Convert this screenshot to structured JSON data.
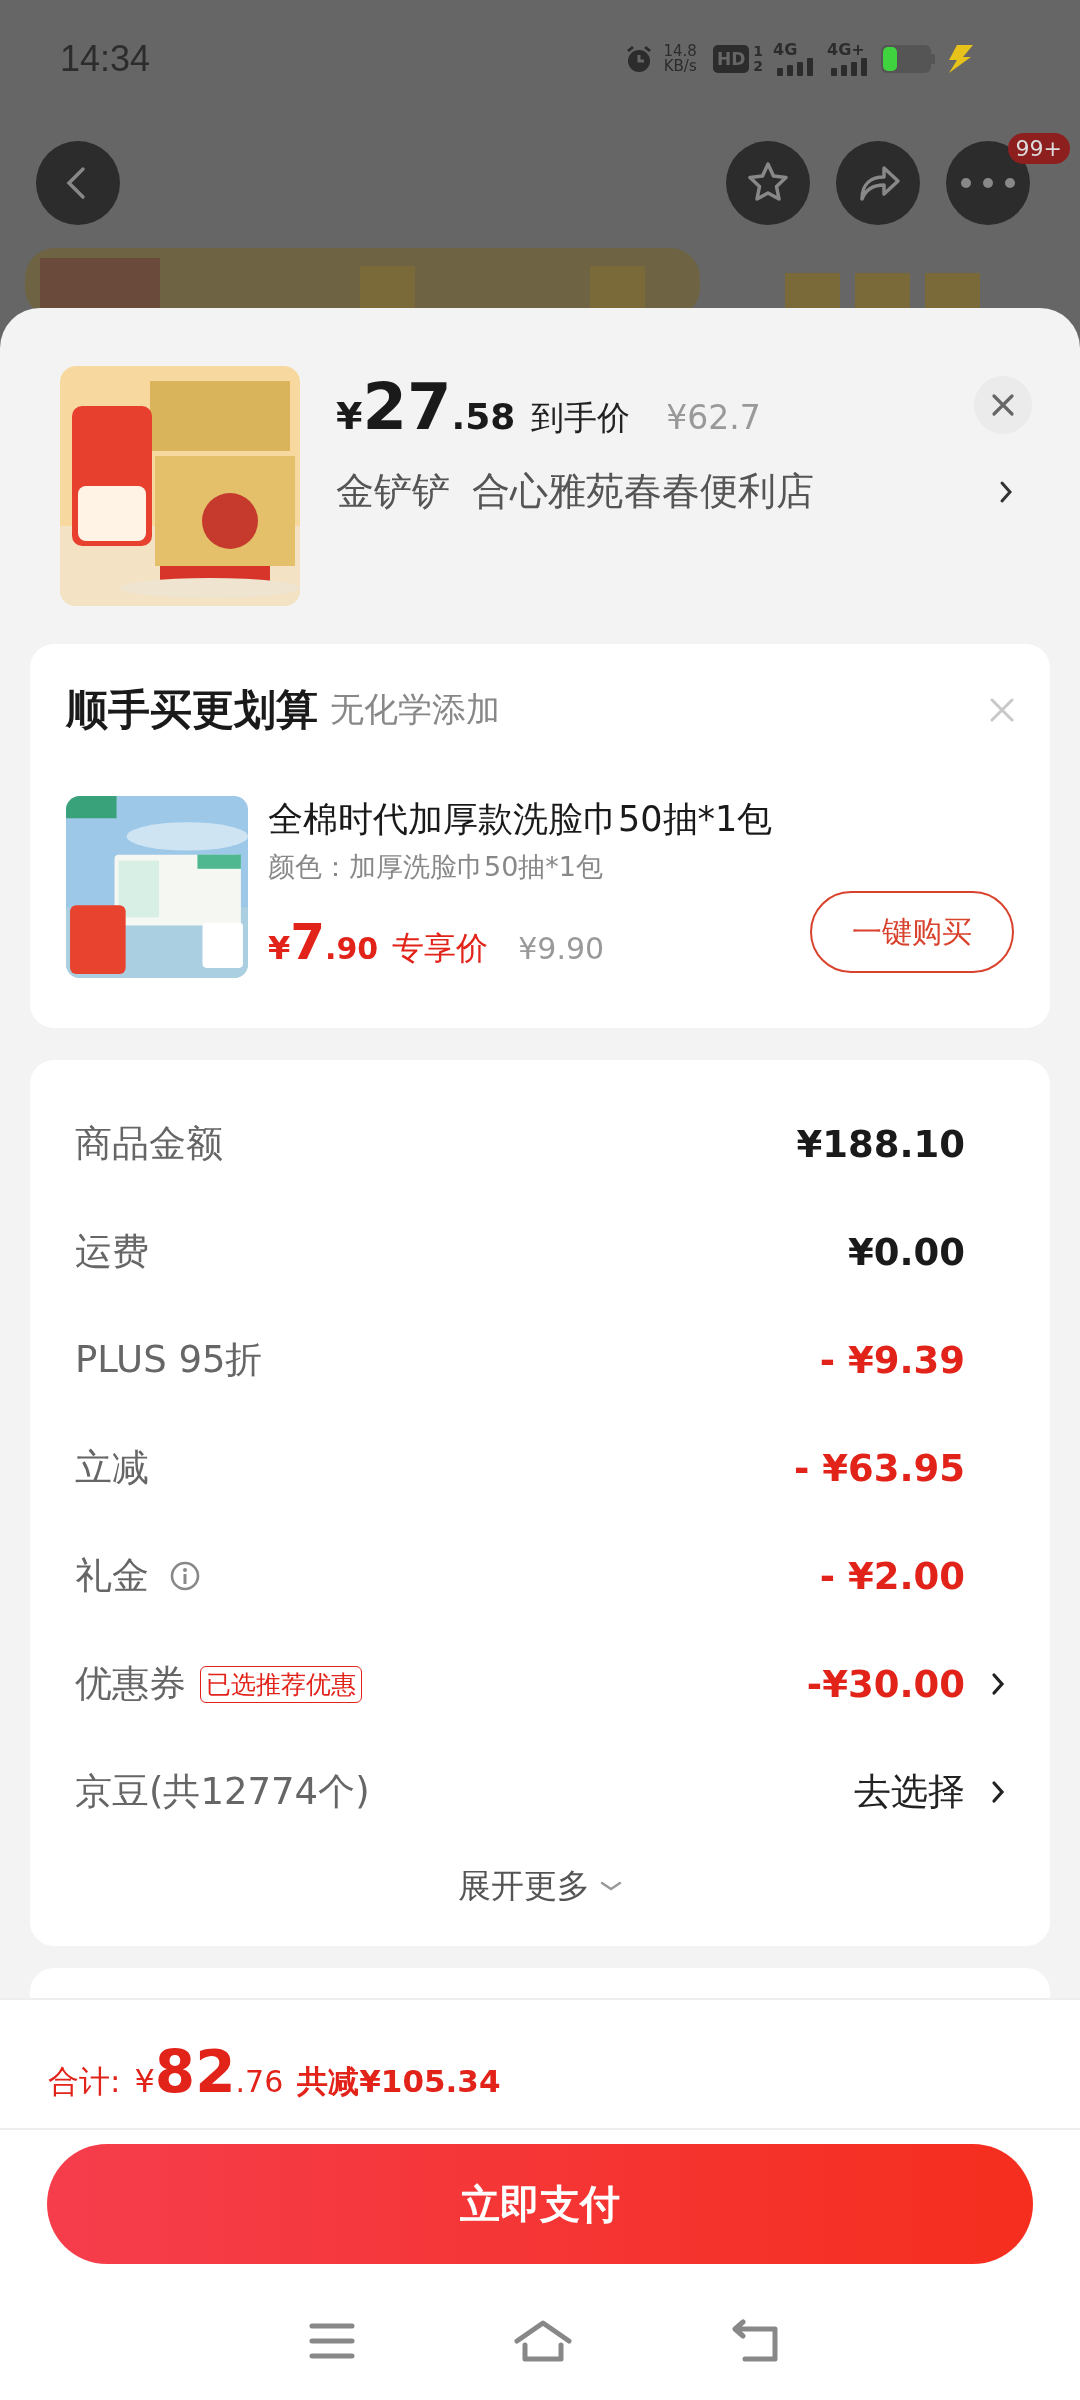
{
  "status_bar": {
    "time": "14:34",
    "speed": [
      "14.8",
      "KB/s"
    ],
    "hd": {
      "label": "HD",
      "sims": [
        "1",
        "2"
      ]
    },
    "signals": [
      "4G",
      "4G+"
    ]
  },
  "top_actions": {
    "more_badge": "99+"
  },
  "product": {
    "currency": "¥",
    "price_int": "27",
    "price_dec": ".58",
    "price_label": "到手价",
    "original_price": "¥62.7",
    "address": [
      "金铲铲",
      "合心雅苑春春便利店"
    ]
  },
  "upsell": {
    "title": "顺手买更划算",
    "subtitle": "无化学添加",
    "item": {
      "name": "全棉时代加厚款洗脸巾50抽*1包",
      "spec": "颜色：加厚洗脸巾50抽*1包",
      "currency": "¥",
      "price_int": "7",
      "price_dec": ".90",
      "price_label": "专享价",
      "original_price": "¥9.90",
      "button": "一键购买"
    }
  },
  "summary": {
    "rows": [
      {
        "kind": "amount",
        "label": "商品金额",
        "value": "¥188.10",
        "info": false
      },
      {
        "kind": "amount",
        "label": "运费",
        "value": "¥0.00",
        "info": false
      },
      {
        "kind": "discount",
        "label": "PLUS 95折",
        "value": "- ¥9.39",
        "info": false
      },
      {
        "kind": "discount",
        "label": "立减",
        "value": "- ¥63.95",
        "info": false
      },
      {
        "kind": "discount",
        "label": "礼金",
        "value": "- ¥2.00",
        "info": true
      },
      {
        "kind": "coupon",
        "label": "优惠券",
        "tag": "已选推荐优惠",
        "value": "-¥30.00",
        "info": false
      },
      {
        "kind": "select",
        "label": "京豆(共12774个)",
        "value": "去选择",
        "info": false
      }
    ],
    "expand": "展开更多"
  },
  "footer": {
    "total_label": "合计:",
    "currency": "¥",
    "total_int": "82",
    "total_dec": ".76",
    "saved": "共减¥105.34",
    "pay_button": "立即支付"
  }
}
